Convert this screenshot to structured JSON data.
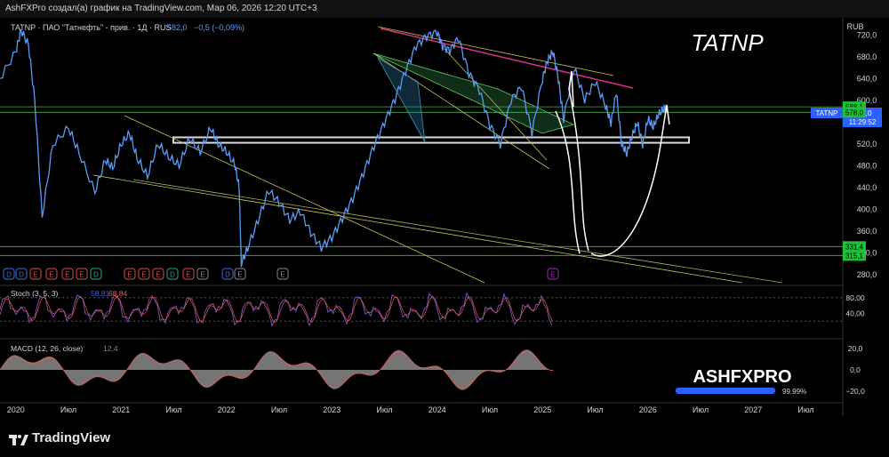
{
  "header": {
    "text": "AshFXPro создал(а) график на TradingView.com, Мар 06, 2026 12:20 UTC+3"
  },
  "footer": {
    "brand": "TradingView"
  },
  "legend": {
    "symbol": "TATNP · ПАО \"Татнефть\" - прив. · 1Д · RUS",
    "value": "582,0",
    "change": "−0,5 (−0,09%)"
  },
  "chart_title": "TATNP",
  "currency": "RUB",
  "price_tag": {
    "symbol": "TATNP",
    "price": "582,0",
    "timer": "11:29:52"
  },
  "level_labels": [
    "588,1",
    "578,0",
    "331,4",
    "315,1"
  ],
  "watermark": {
    "text": "ASHFXPRO",
    "percent": "99.99%",
    "fill": 0.9999
  },
  "colors": {
    "price": "#5b9cf6",
    "accent_line": "#d63384",
    "level_green": "#4caf50",
    "level_badge": "#1fbf3a",
    "tag_blue": "#2962ff"
  },
  "chart_data": [
    {
      "type": "line",
      "name": "price",
      "x_axis": [
        "2020",
        "Июл",
        "2021",
        "Июл",
        "2022",
        "Июл",
        "2023",
        "Июл",
        "2024",
        "Июл",
        "2025",
        "Июл",
        "2026",
        "Июл",
        "2027",
        "Июл"
      ],
      "y_ticks": [
        "720,0",
        "680,0",
        "640,0",
        "600,0",
        "560,0",
        "520,0",
        "480,0",
        "440,0",
        "400,0",
        "360,0",
        "320,0",
        "280,0"
      ],
      "ylim": [
        265,
        745
      ],
      "x_range": [
        2019.85,
        2027.85
      ],
      "t": [
        2019.85,
        2020.0,
        2020.05,
        2020.12,
        2020.18,
        2020.25,
        2020.35,
        2020.5,
        2020.6,
        2020.75,
        2020.85,
        2020.92,
        2021.0,
        2021.08,
        2021.15,
        2021.25,
        2021.35,
        2021.45,
        2021.55,
        2021.65,
        2021.75,
        2021.85,
        2021.92,
        2022.0,
        2022.08,
        2022.12,
        2022.14,
        2022.2,
        2022.3,
        2022.4,
        2022.5,
        2022.6,
        2022.7,
        2022.8,
        2022.9,
        2023.0,
        2023.1,
        2023.2,
        2023.3,
        2023.4,
        2023.5,
        2023.6,
        2023.7,
        2023.8,
        2023.9,
        2024.0,
        2024.05,
        2024.12,
        2024.2,
        2024.3,
        2024.4,
        2024.5,
        2024.6,
        2024.7,
        2024.8,
        2024.9,
        2025.0,
        2025.05,
        2025.1,
        2025.15,
        2025.2,
        2025.3,
        2025.4,
        2025.5,
        2025.6,
        2025.65,
        2025.7,
        2025.75,
        2025.8,
        2025.85,
        2025.9,
        2025.95,
        2026.0,
        2026.05,
        2026.1,
        2026.15,
        2026.18
      ],
      "values": [
        640,
        690,
        735,
        700,
        600,
        380,
        520,
        550,
        510,
        430,
        490,
        470,
        520,
        540,
        500,
        460,
        520,
        490,
        480,
        530,
        510,
        550,
        520,
        500,
        480,
        440,
        305,
        330,
        380,
        430,
        410,
        380,
        400,
        360,
        330,
        345,
        380,
        420,
        470,
        520,
        560,
        600,
        650,
        700,
        720,
        730,
        700,
        690,
        710,
        650,
        620,
        560,
        520,
        600,
        620,
        540,
        640,
        680,
        690,
        640,
        560,
        660,
        600,
        640,
        590,
        560,
        610,
        520,
        500,
        540,
        560,
        520,
        560,
        550,
        570,
        590,
        582
      ]
    },
    {
      "type": "line",
      "name": "Stoch (3, 5, 3)",
      "values_label": [
        "58,81",
        "68,84"
      ],
      "y_ticks": [
        "80,00",
        "40,00"
      ],
      "ylim": [
        0,
        100
      ]
    },
    {
      "type": "bar",
      "name": "MACD (12, 26, close)",
      "values_label": [
        "12,4"
      ],
      "y_ticks": [
        "20,0",
        "0,0",
        "−20,0"
      ],
      "ylim": [
        -25,
        25
      ]
    }
  ]
}
